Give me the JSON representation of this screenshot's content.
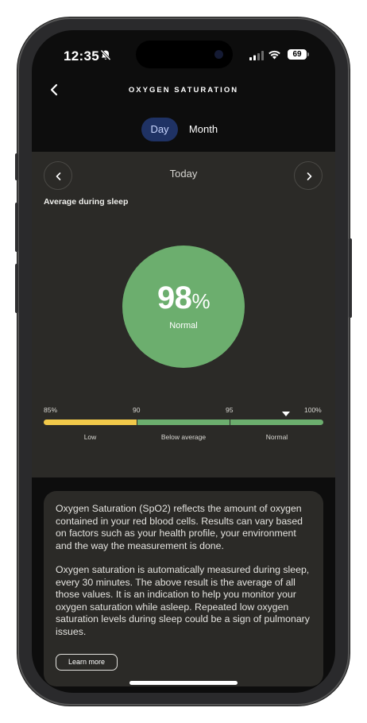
{
  "status_bar": {
    "time": "12:35",
    "battery": "69",
    "icons": [
      "bell-slash-icon",
      "signal-icon",
      "wifi-icon",
      "battery-icon"
    ]
  },
  "header": {
    "title": "OXYGEN SATURATION",
    "back_icon": "chevron-left-icon"
  },
  "tabs": [
    {
      "label": "Day",
      "active": true
    },
    {
      "label": "Month",
      "active": false
    }
  ],
  "date_nav": {
    "label": "Today",
    "prev_icon": "chevron-left-icon",
    "next_icon": "chevron-right-icon"
  },
  "summary": {
    "label": "Average during sleep",
    "value": "98",
    "unit": "%",
    "status": "Normal"
  },
  "scale": {
    "ticks": [
      "85%",
      "90",
      "95",
      "100%"
    ],
    "ranges": [
      "Low",
      "Below average",
      "Normal"
    ],
    "current_value": 98
  },
  "info": {
    "paragraph_1": "Oxygen Saturation (SpO2) reflects the amount of oxygen contained in your red blood cells. Results can vary based on factors such as your health profile, your environment and the way the measurement is done.",
    "paragraph_2": "Oxygen saturation is automatically measured during sleep, every 30 minutes. The above result is the average of all those values. It is an indication to help you monitor your oxygen saturation while asleep. Repeated low oxygen saturation levels during sleep could be a sign of pulmonary issues.",
    "button_label": "Learn more"
  },
  "colors": {
    "accent_green": "#6cae6e",
    "low_yellow": "#f1c94a",
    "tab_active_bg": "#1f3264",
    "panel_bg": "#2b2a27"
  }
}
